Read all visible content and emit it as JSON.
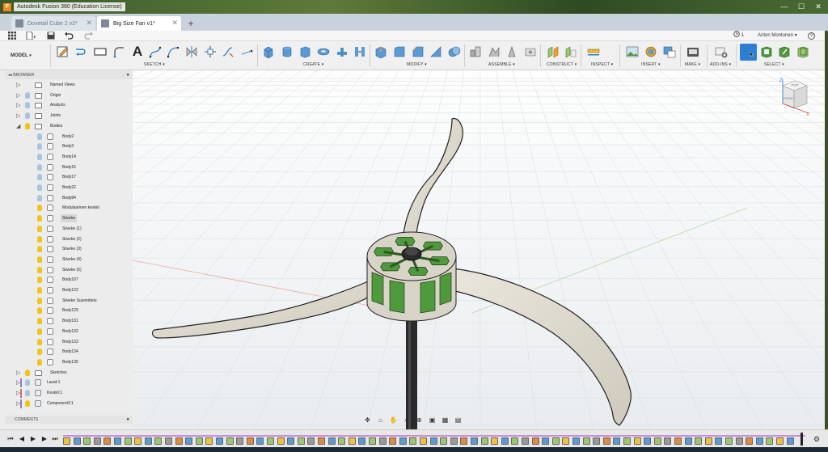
{
  "window": {
    "title": "Autodesk Fusion 360 (Education License)",
    "app_icon_letter": "F",
    "controls": [
      "—",
      "☐",
      "✕"
    ]
  },
  "tabs": [
    {
      "label": "Dovetail Cube 2 v2*",
      "active": false,
      "close": "✕"
    },
    {
      "label": "Big Size Fan v1*",
      "active": true,
      "close": "✕"
    }
  ],
  "tab_add": "+",
  "quick_access": {
    "job_count": "1",
    "user": "Anton Montonen",
    "user_caret": "▾",
    "help": "?"
  },
  "toolbar": {
    "workspace": "MODEL",
    "workspace_caret": "▾",
    "groups": [
      "SKETCH",
      "CREATE",
      "MODIFY",
      "ASSEMBLE",
      "CONSTRUCT",
      "INSPECT",
      "INSERT",
      "MAKE",
      "ADD-INS",
      "SELECT"
    ],
    "group_caret": "▾",
    "accent_color": "#2a7fd4",
    "body_color": "#4f9a3c"
  },
  "browser": {
    "title": "BROWSER",
    "collapse_glyph": "◂◂",
    "pin_glyph": "●",
    "items": [
      {
        "label": "Named Views",
        "kind": "folder",
        "expander": "▷",
        "bulb": "none"
      },
      {
        "label": "Origin",
        "kind": "folder",
        "expander": "▷",
        "bulb": "off"
      },
      {
        "label": "Analysis",
        "kind": "folder",
        "expander": "▷",
        "bulb": "off"
      },
      {
        "label": "Joints",
        "kind": "folder",
        "expander": "▷",
        "bulb": "off"
      },
      {
        "label": "Bodies",
        "kind": "folder",
        "expander": "◢",
        "bulb": "on"
      },
      {
        "label": "Body2",
        "kind": "body",
        "bulb": "off"
      },
      {
        "label": "Body3",
        "kind": "body",
        "bulb": "off"
      },
      {
        "label": "Body14",
        "kind": "body",
        "bulb": "off"
      },
      {
        "label": "Body15",
        "kind": "body",
        "bulb": "off"
      },
      {
        "label": "Body17",
        "kind": "body",
        "bulb": "off"
      },
      {
        "label": "Body22",
        "kind": "body",
        "bulb": "off"
      },
      {
        "label": "Body84",
        "kind": "body",
        "bulb": "off"
      },
      {
        "label": "Modulaarinen keskiö",
        "kind": "body",
        "bulb": "on"
      },
      {
        "label": "Siiveke",
        "kind": "body",
        "bulb": "on",
        "selected": true
      },
      {
        "label": "Siiveke (1)",
        "kind": "body",
        "bulb": "on"
      },
      {
        "label": "Siiveke (2)",
        "kind": "body",
        "bulb": "on"
      },
      {
        "label": "Siiveke (3)",
        "kind": "body",
        "bulb": "on"
      },
      {
        "label": "Siiveke (4)",
        "kind": "body",
        "bulb": "on"
      },
      {
        "label": "Siiveke (5)",
        "kind": "body",
        "bulb": "on"
      },
      {
        "label": "Body107",
        "kind": "body",
        "bulb": "on"
      },
      {
        "label": "Body122",
        "kind": "body",
        "bulb": "on"
      },
      {
        "label": "Siiveke Suunnittelu",
        "kind": "body",
        "bulb": "on"
      },
      {
        "label": "Body129",
        "kind": "body",
        "bulb": "on"
      },
      {
        "label": "Body131",
        "kind": "body",
        "bulb": "on"
      },
      {
        "label": "Body132",
        "kind": "body",
        "bulb": "on"
      },
      {
        "label": "Body133",
        "kind": "body",
        "bulb": "on"
      },
      {
        "label": "Body134",
        "kind": "body",
        "bulb": "on"
      },
      {
        "label": "Body135",
        "kind": "body",
        "bulb": "on"
      },
      {
        "label": "Sketches",
        "kind": "folder",
        "expander": "▷",
        "bulb": "on"
      },
      {
        "label": "Lavat:1",
        "kind": "component",
        "expander": "▷",
        "bulb": "off"
      },
      {
        "label": "Keskiö:1",
        "kind": "component",
        "expander": "▷",
        "bulb": "off"
      },
      {
        "label": "Component3:1",
        "kind": "component",
        "expander": "▷",
        "bulb": "on"
      }
    ]
  },
  "comments": {
    "title": "COMMENTS",
    "pin_glyph": "●"
  },
  "viewcube": {
    "top": "TOP",
    "front": "FRONT",
    "axis_z": "Z",
    "axis_x": "X"
  },
  "navbar": {
    "icons": [
      "orbit-icon",
      "look-at-icon",
      "pan-icon",
      "zoom-icon",
      "zoom-window-icon",
      "display-settings-icon",
      "grid-icon",
      "viewports-icon"
    ]
  },
  "timeline": {
    "controls": [
      "⏮",
      "◀",
      "▶",
      "▶",
      "⏭"
    ],
    "settings": "⚙"
  }
}
